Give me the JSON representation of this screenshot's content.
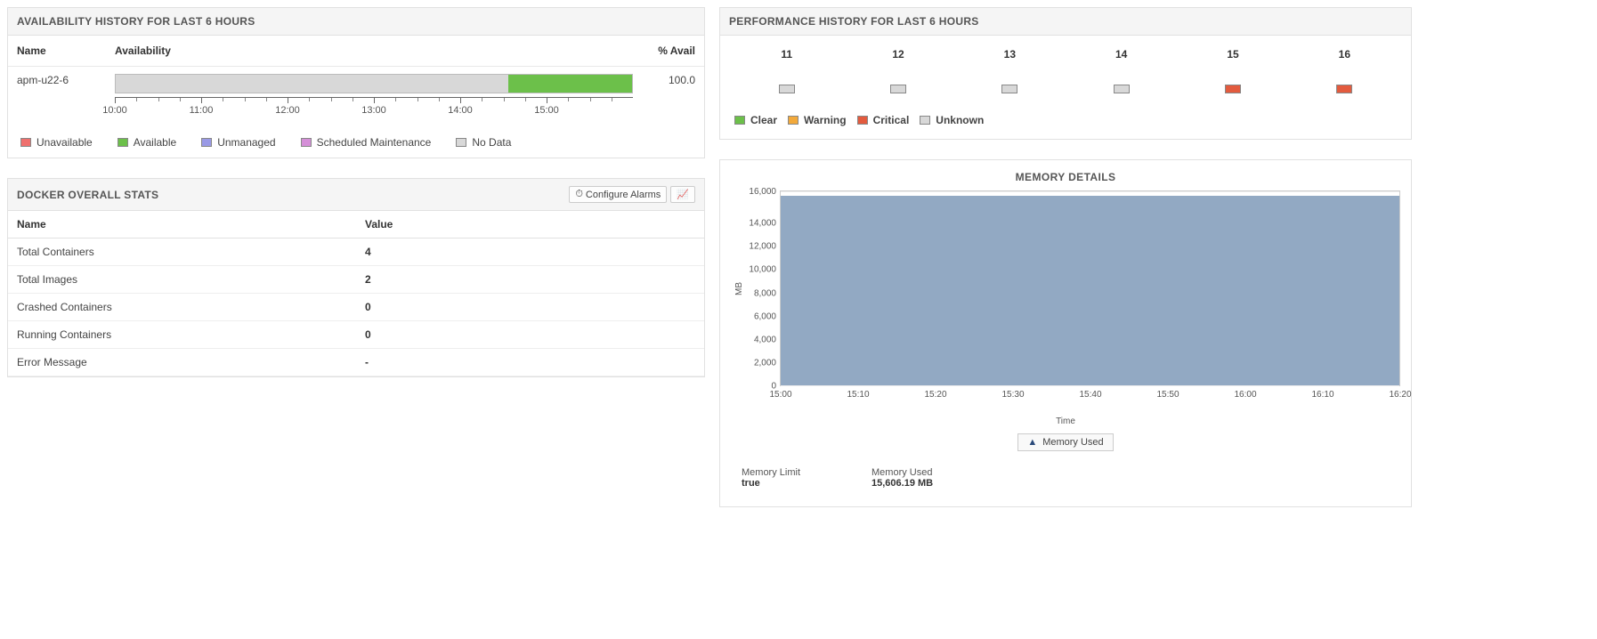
{
  "colors": {
    "unavailable": "#ef706e",
    "available": "#6cc04a",
    "unmanaged": "#9a9ae6",
    "scheduled": "#d58fd8",
    "nodata": "#d8d8d8",
    "clear": "#6cc04a",
    "warning": "#f2a93b",
    "critical": "#e35b3e",
    "unknown": "#d8d8d8",
    "memfill": "#8ca4c0"
  },
  "availability": {
    "title": "AVAILABILITY HISTORY FOR LAST 6 HOURS",
    "headers": {
      "name": "Name",
      "availability": "Availability",
      "pct": "% Avail"
    },
    "row": {
      "name": "apm-u22-6",
      "pct": "100.0"
    },
    "axis_ticks": [
      "10:00",
      "11:00",
      "12:00",
      "13:00",
      "14:00",
      "15:00"
    ],
    "legend": {
      "unavailable": "Unavailable",
      "available": "Available",
      "unmanaged": "Unmanaged",
      "scheduled": "Scheduled Maintenance",
      "nodata": "No Data"
    },
    "segments": [
      {
        "state": "nodata",
        "start_pct": 0,
        "width_pct": 76
      },
      {
        "state": "available",
        "start_pct": 76,
        "width_pct": 24
      }
    ]
  },
  "performance": {
    "title": "PERFORMANCE HISTORY FOR LAST 6 HOURS",
    "hours": [
      "11",
      "12",
      "13",
      "14",
      "15",
      "16"
    ],
    "states": [
      "unknown",
      "unknown",
      "unknown",
      "unknown",
      "critical",
      "critical"
    ],
    "legend": {
      "clear": "Clear",
      "warning": "Warning",
      "critical": "Critical",
      "unknown": "Unknown"
    }
  },
  "docker": {
    "title": "DOCKER OVERALL STATS",
    "configure_label": "Configure Alarms",
    "headers": {
      "name": "Name",
      "value": "Value"
    },
    "rows": [
      {
        "name": "Total Containers",
        "value": "4"
      },
      {
        "name": "Total Images",
        "value": "2"
      },
      {
        "name": "Crashed Containers",
        "value": "0"
      },
      {
        "name": "Running Containers",
        "value": "0"
      },
      {
        "name": "Error Message",
        "value": "-"
      }
    ]
  },
  "memory": {
    "title": "MEMORY DETAILS",
    "ylabel": "MB",
    "xlabel": "Time",
    "legend": "Memory Used",
    "summary": {
      "limit_label": "Memory Limit",
      "limit_value": "true",
      "used_label": "Memory Used",
      "used_value": "15,606.19 MB"
    }
  },
  "chart_data": {
    "type": "area",
    "title": "MEMORY DETAILS",
    "xlabel": "Time",
    "ylabel": "MB",
    "ylim": [
      0,
      16000
    ],
    "yticks": [
      0,
      2000,
      4000,
      6000,
      8000,
      10000,
      12000,
      14000,
      16000
    ],
    "x": [
      "15:00",
      "15:10",
      "15:20",
      "15:30",
      "15:40",
      "15:50",
      "16:00",
      "16:10",
      "16:20"
    ],
    "series": [
      {
        "name": "Memory Used",
        "values": [
          15606,
          15606,
          15606,
          15606,
          15606,
          15606,
          15606,
          15606,
          15606
        ]
      }
    ]
  }
}
